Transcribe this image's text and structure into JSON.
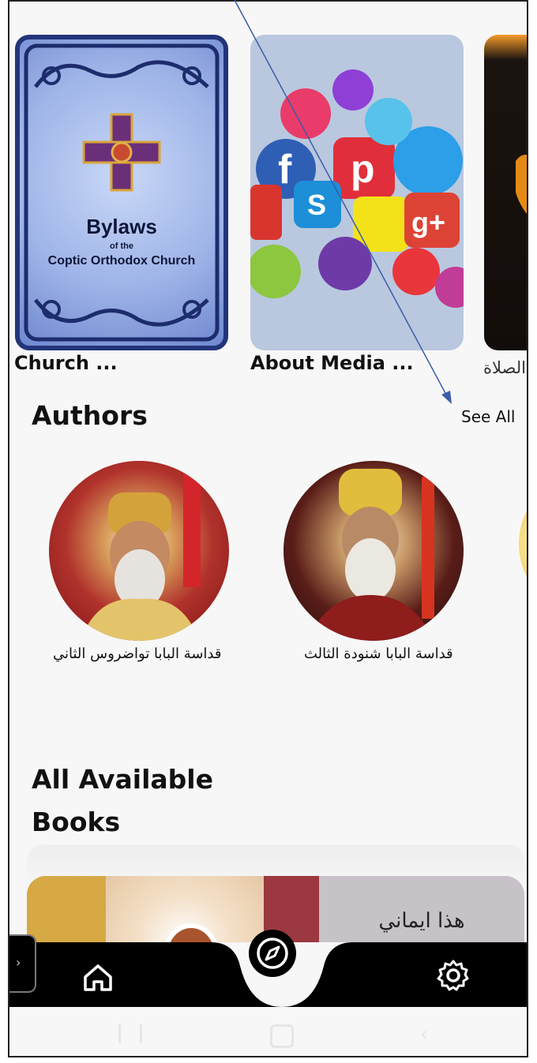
{
  "books_row": [
    {
      "title": "Church ...",
      "cover_title": "Bylaws",
      "cover_subtitle": "of the",
      "cover_org": "Coptic Orthodox Church"
    },
    {
      "title": "About Media ..."
    },
    {
      "title": "الصلاة"
    }
  ],
  "authors": {
    "heading": "Authors",
    "see_all": "See All",
    "items": [
      {
        "name": "قداسة البابا تواضروس الثاني"
      },
      {
        "name": "قداسة البابا شنودة الثالث"
      }
    ]
  },
  "all_books": {
    "heading_line1": "All Available",
    "heading_line2": "Books",
    "featured_title": "هذا ايماني"
  },
  "bottom_nav": {
    "home_icon": "home-icon",
    "explore_icon": "compass-icon",
    "settings_icon": "gear-icon"
  },
  "colors": {
    "background": "#f7f7f7",
    "nav_bar": "#000000",
    "cover_blue": "#9fb4e8",
    "media_bg": "#b9c8df"
  }
}
